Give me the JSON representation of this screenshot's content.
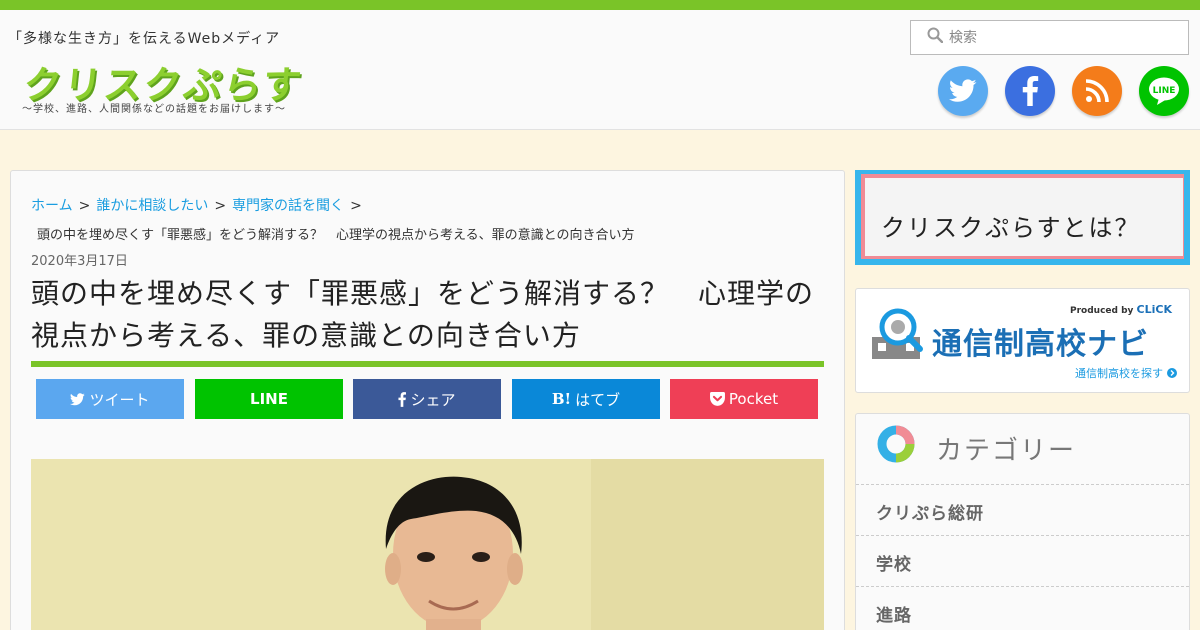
{
  "header": {
    "tagline": "「多様な生き方」を伝えるWebメディア",
    "logo": "クリスクぷらす",
    "logo_sub": "〜学校、進路、人間関係などの話題をお届けします〜",
    "search_placeholder": "検索",
    "social": [
      {
        "name": "twitter-icon",
        "color": "#5aaaf0"
      },
      {
        "name": "facebook-icon",
        "color": "#3b6fe0"
      },
      {
        "name": "rss-icon",
        "color": "#f47c1a"
      },
      {
        "name": "line-icon",
        "color": "#00c300",
        "label": "LINE"
      }
    ],
    "brand_color": "#7ac428"
  },
  "article": {
    "breadcrumbs": [
      "ホーム",
      "誰かに相談したい",
      "専門家の話を聞く"
    ],
    "separator": ">",
    "current": "頭の中を埋め尽くす「罪悪感」をどう解消する？　心理学の視点から考える、罪の意識との向き合い方",
    "date": "2020年3月17日",
    "title": "頭の中を埋め尽くす「罪悪感」をどう解消する？　心理学の視点から考える、罪の意識との向き合い方",
    "share": [
      {
        "label": "ツイート",
        "icon": "twitter-icon",
        "color": "#5ba7ef"
      },
      {
        "label": "LINE",
        "icon": "",
        "color": "#00c300"
      },
      {
        "label": "シェア",
        "icon": "facebook-icon",
        "color": "#3b5998"
      },
      {
        "label": "はてブ",
        "icon": "hatena-icon",
        "icon_text": "B!",
        "color": "#0a88d8"
      },
      {
        "label": "Pocket",
        "icon": "pocket-icon",
        "color": "#ef3f56"
      }
    ]
  },
  "sidebar": {
    "about": "クリスクぷらすとは？",
    "navi": {
      "produced_by": "Produced by",
      "produced_brand": "CLiCK",
      "title": "通信制高校ナビ",
      "link": "通信制高校を探す"
    },
    "category": {
      "heading": "カテゴリー",
      "items": [
        "クリぷら総研",
        "学校",
        "進路"
      ]
    }
  }
}
